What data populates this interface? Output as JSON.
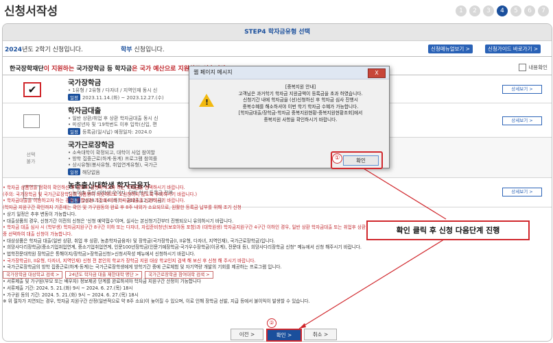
{
  "page": {
    "title": "신청서작성",
    "steps": [
      "1",
      "2",
      "3",
      "4",
      "5",
      "6",
      "7"
    ],
    "active_step": "4"
  },
  "step_bar": {
    "label": "STEP4 학자금유형 선택"
  },
  "info": {
    "semester_year": "2024",
    "semester_rest": "년도 2학기 신청입니다.",
    "dept_name": "학부",
    "dept_rest": " 신청입니다.",
    "guide_btn1": "신청매뉴얼보기 >",
    "guide_btn2": "신청가이드 바로가기 >"
  },
  "notice": {
    "prefix": "한국장학재단",
    "mid": "이 지원하는 ",
    "bold": "국가장학금 등 학자금",
    "suffix": "은 국가 예산으로 지원하고 있습니다.",
    "check_all": "내용확인"
  },
  "aid_types": [
    {
      "title": "국가장학금",
      "line1": "• 1유형 / 2유형 / 다자녀 / 지역인재 동시 신",
      "period_label": "일정",
      "period": "2023.11.14.(화) ~ 2023.12.27.(수)",
      "detail": "상세보기 >",
      "checked": true
    },
    {
      "title": "학자금대출",
      "line1": "• 일반 상환/취업 후 상환 학자금대출 동시 신",
      "line2": "• 미성년자 및 '19학번도 이후 입학(신입, 편",
      "period_label": "일정",
      "period": "등록금(일시납) 예정일자: 2024.0",
      "detail": "상세보기 >",
      "checked": false
    },
    {
      "title": "국가근로장학금",
      "line1": "• 소속대학이 확정되고, 대학이 사업 참여할",
      "line2": "• 방학 집중근로(하계·동계) 프로그램 참여를",
      "line3": "• 상시유형(봉사유형, 취업연계유형), 국가근",
      "period_label": "일정",
      "period": "해당없음",
      "unavailable": "선택\n불가"
    },
    {
      "title": "농촌출신대학생 학자금융자",
      "line1": "• 농어촌 출신 대학생 우어자, 당해 학기 등록금 전액",
      "period_label": "일정",
      "period": "2024.11.14.(화) ~ 2024.12.27.(금)",
      "detail": "상세보기 >",
      "checked": false
    }
  ],
  "notes": [
    "• 학자금 상품명을 정확히 확인하신 후 반드시 신청하시고자 하는 학자금을 선택하시기 바랍니다.",
    "(주의: 국가장학금 및 국가근로장학금의 상품명이 비슷하므로 오신청하지 않도록 주의하시기 바랍니다.)",
    "• 학자금대출을 이용하고자 하는 경우, 통합신청 기간에 미리 학자금대출을 신청하시기 바랍니다.",
    "(학자금 지원구간 확인까지 기존에는 확인 및 가구원동의 완료 후 8주 내외가 소요되므로, 원활한 등록금 납부를 위해 조기 신청",
    "• 상기 일정은 추후 변동이 가능합니다.",
    "• 대출상품의 경우, 신청기간 이전의 신청은 '신청 예약접수'이며, 실사는 본신청기간부터 진행되오니 유의하시기 바랍니다.",
    "• 학자금 대출 심사 시 (학부생) 학자금지원구간 8구간 이하 또는 다자녀, 자립준비청년(보호아동 포함)과 (대학원생) 학자금지원구간 4구간 이하인 경우, 일반 상환 학자금대출 또는 취업후 상환 학자금대출",
    "중 선택하여 대출 신청이 가능합니다.",
    "• 대상상품은 학자금 대출(일반 상환, 취업 후 상환, 농촌학자금융자) 및 장학금(국가장학금(I, II유형, 다자녀, 지역인재), 국가근로장학금)입니다.",
    "• 희망사다리장학금(중소기업취업연계, 중소기업취업연계, 인문100년장학금(인문기예장학금·국가우수장학금(이공계), 전문대 등), 희망사다리장학금 신청\" 메뉴에서 신청 해주시기 바랍니다.",
    "• 법학전문대학원 장학금은 통해이지/장학금>장학금신청>신청서작성 메뉴에서 신청하시기 바랍니다.",
    "• 국가장학금(I, II유형, 다자녀, 지역인재) 신청 전 본인의 학교가 장학금 지원 대상 학교인지 검색 해 보신 후 신청 해 주시기 바랍니다.",
    "• 국가근로장학금의 방학 집중근로(하계·동계)는 국가근로장학생에게 방학기간 중에 근로체험 및 자기역량 개발의 기회를 제공하는 프로그램 입니다."
  ],
  "note_links": [
    "국가장학금 대상학교 검색 >",
    "24년도 학자금 대출 제한대학 명단 >",
    "국가근로장학금 참여대학 검색 >"
  ],
  "notes2": [
    "• 서류제출 및 가구원(부모 또는 배우자) 정보제공 단계를 완료하셔야 학자금 지원구간 산정이 가능합니다",
    "• 서류제출 기간: 2024. 5. 21.(화) 9시 ~ 2024. 6. 27.(목) 18시",
    "• 가구원 동의 기간: 2024. 5. 21.(화) 9시 ~ 2024. 6. 27.(목) 18시",
    "※ 위 절차가 지연되는 경우, 학자금 지원구간 산정(일반적으로 약 8주 소요)이 늦어질 수 있으며, 이로 인해 장학금 선발, 지급 등에서 불이익이 발생할 수 있습니다."
  ],
  "bottom_buttons": {
    "prev": "이전 >",
    "confirm": "확인 >",
    "cancel": "취소 >"
  },
  "dialog": {
    "title": "웹 페이지 메시지",
    "close": "X",
    "lines": [
      "[중복지원 안내]",
      "고객님은 과거학기 학자금 지원금액이 등록금을 초과 하였습니다.",
      "신청기간 내에 학자금을 (선)신청하신 후 학자금 심사 진행시",
      "중복수혜를 해소하셔야 이번 학기 학자금 수혜가 가능합니다.",
      "[학자금대출/장학금-학자금 중복지원현황-중복지원현황조회]에서",
      "중복지원 사항을 확인하시기 바랍니다."
    ],
    "ok": "확인"
  },
  "annotations": {
    "marker1": "①",
    "marker2": "②",
    "callout": "확인 클릭 후 신청 다음단계 진행"
  },
  "colors": {
    "brand": "#1a4f9c",
    "highlight": "#d0262b"
  }
}
